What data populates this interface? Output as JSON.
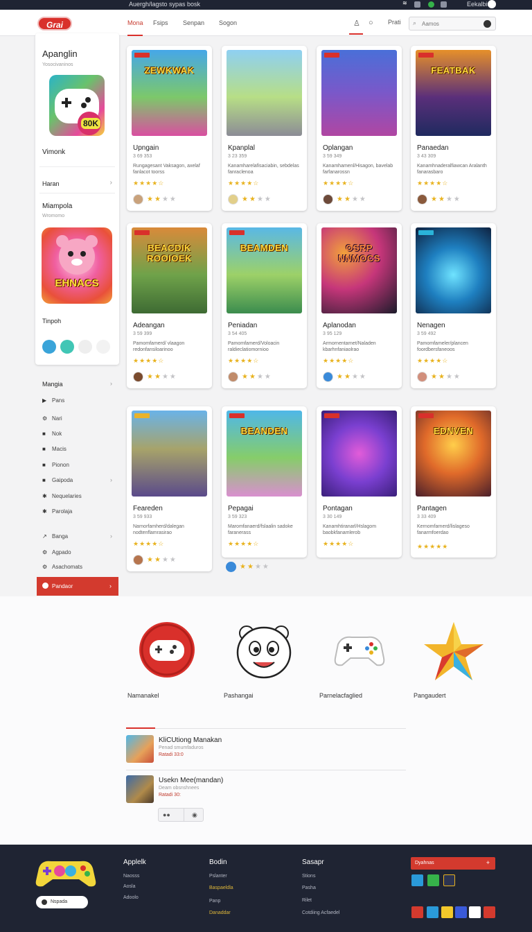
{
  "topbar": {
    "text": "Auergh/lagsto sypas bosk",
    "right_text": "Eekalbium"
  },
  "header": {
    "logo": "Grai",
    "nav": [
      "Mona",
      "Fsips",
      "Senpan",
      "Sogon"
    ],
    "right_link": "Prati",
    "search_placeholder": "Aamos"
  },
  "sidebar": {
    "title": "Apanglin",
    "subtitle": "Yosocivaninos",
    "badge": "80K",
    "label1": "Vimonk",
    "link": "Haran",
    "section2": "Miampola",
    "section2_sub": "Wromomo",
    "promo_text": "EHNACS",
    "label3": "Tinpoh"
  },
  "menu": {
    "items": [
      {
        "icon": "▶",
        "label": "Pans"
      },
      {
        "icon": "⚙",
        "label": "Nari"
      },
      {
        "icon": "■",
        "label": "Nok"
      },
      {
        "icon": "■",
        "label": "Macis"
      },
      {
        "icon": "■",
        "label": "Pionon"
      },
      {
        "icon": "■",
        "label": "Gaipoda"
      },
      {
        "icon": "✱",
        "label": "Nequelaries"
      },
      {
        "icon": "✱",
        "label": "Parolaja"
      },
      {
        "icon": "↗",
        "label": "Banga"
      },
      {
        "icon": "⚙",
        "label": "Agpado"
      },
      {
        "icon": "⚙",
        "label": "Asachomats"
      }
    ],
    "heading": "Mangia",
    "cta": "Pandaor"
  },
  "cards": [
    {
      "title": "Upngain",
      "meta": "3 69 353",
      "desc": "Rungagesant Vaksagon, axelaf fanlacot toorss",
      "art": "ZEWKWAK",
      "stars": 2
    },
    {
      "title": "Kpanplal",
      "meta": "3 23 359",
      "desc": "Kanamharelafisaciabin, sebdelas fanraclenoa",
      "art": "",
      "stars": 2
    },
    {
      "title": "Oplangan",
      "meta": "3 59 349",
      "desc": "Kanamhamenl/Hisagon, bavelab farfanarossn",
      "art": "",
      "stars": 2
    },
    {
      "title": "Panaedan",
      "meta": "3 43 309",
      "desc": "Kanamhnaderalfiawcan Aralanth fanarasbaro",
      "art": "FEATBAK",
      "stars": 2
    },
    {
      "title": "Adeangan",
      "meta": "3 59 399",
      "desc": "Pamomfamerd/ vlaagon redonfansiloarinoo",
      "art": "BEACDIK ROOIOEK",
      "stars": 2
    },
    {
      "title": "Peniadan",
      "meta": "3 54 405",
      "desc": "Pamomfamerd/Voloacin raldieclatiomornioo",
      "art": "BEAMDEN",
      "stars": 2
    },
    {
      "title": "Aplanodan",
      "meta": "3 95 129",
      "desc": "Armornentarnet/Naladen kbarhnfaniaolrao",
      "art": "OSRP NNMOCS",
      "stars": 2
    },
    {
      "title": "Nenagen",
      "meta": "3 59 492",
      "desc": "Pamomfameler/plancen foordbersfaneoos",
      "art": "",
      "stars": 2
    },
    {
      "title": "Feareden",
      "meta": "3 59 933",
      "desc": "Narnorfamherd/dalegan nodtenflamrasirao",
      "art": "",
      "stars": 2
    },
    {
      "title": "Pepagai",
      "meta": "3 59 323",
      "desc": "Maromfanaerd/fslaalin sadoke faranerass",
      "art": "BEANDEN",
      "stars": 2
    },
    {
      "title": "Pontagan",
      "meta": "3 30 149",
      "desc": "Kanamhtiranarl/Hslagom baobkfanamlerob",
      "art": "",
      "stars": 2
    },
    {
      "title": "Pantagen",
      "meta": "3 33 409",
      "desc": "Kernomfarnerd/lislageso fanarmfoerdao",
      "art": "EDNVEN",
      "stars": 5
    }
  ],
  "features": [
    {
      "label": "Namanakel",
      "icon": "gamepad-red"
    },
    {
      "label": "Pashangai",
      "icon": "mascot-face"
    },
    {
      "label": "Parnelacfaglied",
      "icon": "controller-white"
    },
    {
      "label": "Pangaudert",
      "icon": "star"
    }
  ],
  "news": [
    {
      "title": "KliCUtiong Manakan",
      "sub": "Penad smumfaduros",
      "date": "Ratadi 33:0"
    },
    {
      "title": "Usekn Mee(mandan)",
      "sub": "Deam obsnshnees",
      "date": "Ratadi 30:"
    }
  ],
  "pager": {
    "dots": "●●",
    "end": "◉"
  },
  "footer": {
    "pill": "Nspada",
    "cols": [
      {
        "title": "Applelk",
        "links": [
          "Naosss",
          "Aosla",
          "Adoolo"
        ]
      },
      {
        "title": "Bodin",
        "links": [
          "Pslanter",
          "Baspaeldla",
          "Panp",
          "Danaddar"
        ]
      },
      {
        "title": "Sasapr",
        "links": [
          "Stions",
          "Pasha",
          "Rilet",
          "Cotdiing Acfaedel"
        ]
      }
    ],
    "cta": "Dyahnas",
    "colors": {
      "brand": "#d9302b",
      "dark": "#1f2433",
      "star": "#e8b21e"
    }
  }
}
